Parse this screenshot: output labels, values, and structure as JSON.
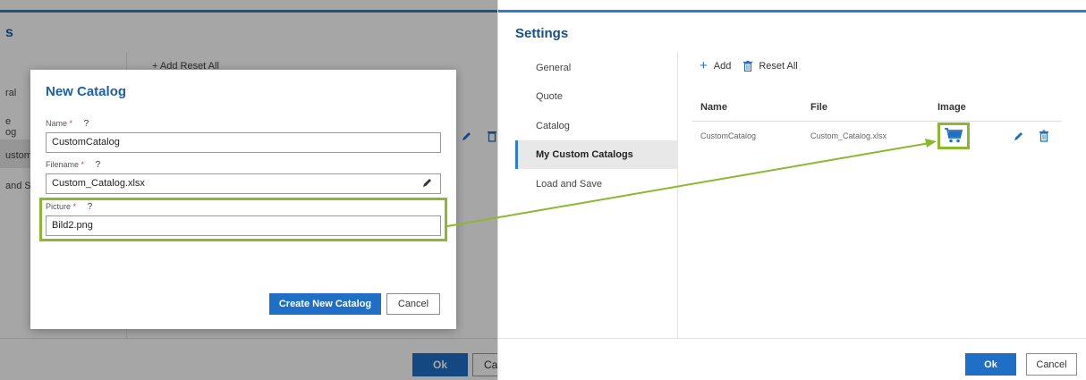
{
  "left_panel": {
    "title_fragment": "s",
    "nav_fragments": [
      "ral",
      "e",
      "og",
      "ustom",
      "and S"
    ],
    "toolbar_fragment": "+ Add   Reset All",
    "ok_label": "Ok",
    "cancel_fragment": "Ca"
  },
  "modal": {
    "title": "New Catalog",
    "name_label": "Name",
    "filename_label": "Filename",
    "picture_label": "Picture",
    "required_mark": "*",
    "help_mark": "?",
    "name_value": "CustomCatalog",
    "filename_value": "Custom_Catalog.xlsx",
    "picture_value": "Bild2.png",
    "create_label": "Create New Catalog",
    "cancel_label": "Cancel"
  },
  "settings": {
    "title": "Settings",
    "nav": [
      {
        "label": "General"
      },
      {
        "label": "Quote"
      },
      {
        "label": "Catalog"
      },
      {
        "label": "My Custom Catalogs"
      },
      {
        "label": "Load and Save"
      }
    ],
    "toolbar": {
      "add_label": "Add",
      "reset_label": "Reset All"
    },
    "table": {
      "columns": [
        "Name",
        "File",
        "Image"
      ],
      "rows": [
        {
          "name": "CustomCatalog",
          "file": "Custom_Catalog.xlsx",
          "image": "cart-icon"
        }
      ]
    },
    "ok_label": "Ok",
    "cancel_label": "Cancel"
  },
  "colors": {
    "accent": "#1f6fc7",
    "highlight": "#8ab82e",
    "title": "#1a5fa8"
  }
}
